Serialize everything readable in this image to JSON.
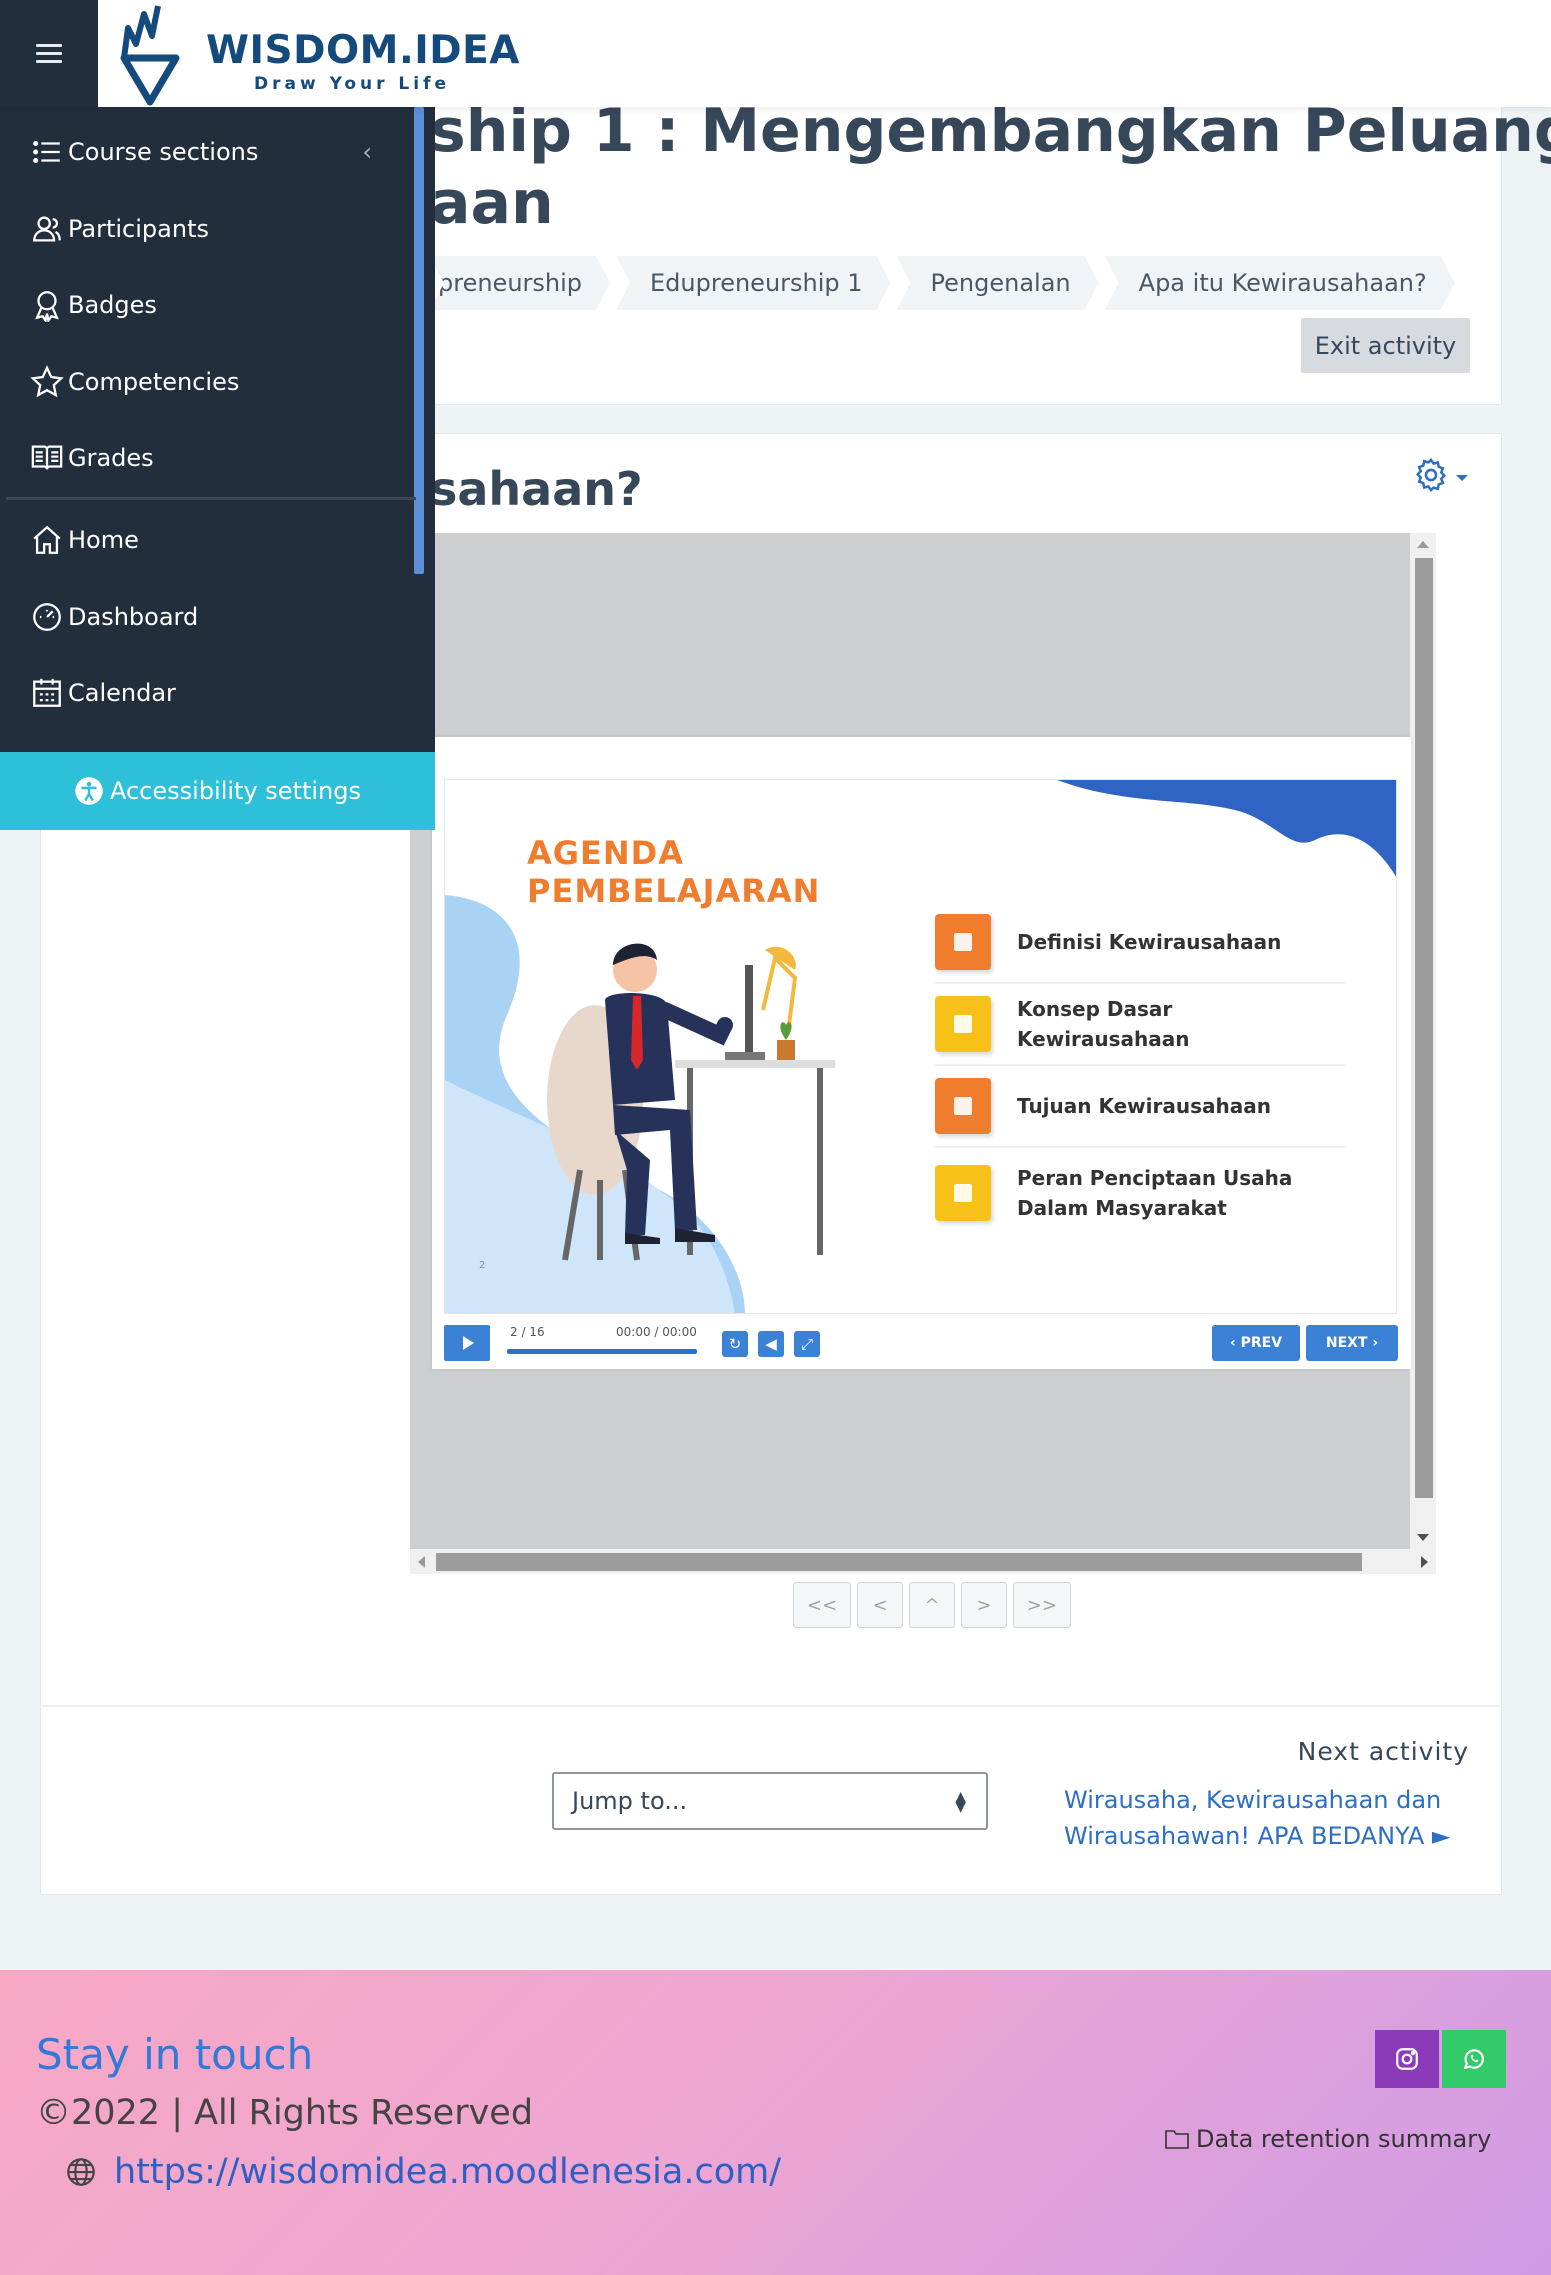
{
  "header": {
    "brand_name": "WISDOM.IDEA",
    "brand_tagline": "Draw Your Life",
    "brand_color": "#154a7c"
  },
  "sidebar": {
    "items": [
      {
        "label": "Course sections",
        "icon": "list-icon"
      },
      {
        "label": "Participants",
        "icon": "participants-icon"
      },
      {
        "label": "Badges",
        "icon": "badge-icon"
      },
      {
        "label": "Competencies",
        "icon": "star-icon"
      },
      {
        "label": "Grades",
        "icon": "grades-icon"
      },
      {
        "label": "Home",
        "icon": "home-icon"
      },
      {
        "label": "Dashboard",
        "icon": "dashboard-icon"
      },
      {
        "label": "Calendar",
        "icon": "calendar-icon"
      }
    ],
    "accessibility_label": "Accessibility settings",
    "accent_color": "#2ec0d8"
  },
  "page": {
    "title_line1": "ship 1 : Mengembangkan Peluang",
    "title_line2": "aan",
    "breadcrumbs": [
      "preneurship",
      "Edupreneurship 1",
      "Pengenalan",
      "Apa itu Kewirausahaan?"
    ],
    "exit_label": "Exit activity",
    "section_title": "sahaan?"
  },
  "slide": {
    "agenda_title_1": "AGENDA",
    "agenda_title_2": "PEMBELAJARAN",
    "items": [
      {
        "text": "Definisi Kewirausahaan",
        "color": "#f07c2e"
      },
      {
        "text": "Konsep Dasar Kewirausahaan",
        "color": "#f8c11a"
      },
      {
        "text": "Tujuan Kewirausahaan",
        "color": "#f07c2e"
      },
      {
        "text": "Peran Penciptaan Usaha Dalam Masyarakat",
        "color": "#f8c11a"
      }
    ],
    "slide_number": "2",
    "progress": "2 / 16",
    "time": "00:00 / 00:00",
    "prev_label": "‹ PREV",
    "next_label": "NEXT ›"
  },
  "pager": [
    "<<",
    "<",
    "^",
    ">",
    ">>"
  ],
  "navigation": {
    "jump_placeholder": "Jump to...",
    "next_activity_label": "Next activity",
    "next_activity_link": "Wirausaha, Kewirausahaan dan Wirausahawan! APA BEDANYA ►"
  },
  "footer": {
    "stay_in_touch": "Stay in touch",
    "copyright": "©2022 | All Rights Reserved",
    "site_url": "https://wisdomidea.moodlenesia.com/",
    "data_retention": "Data retention summary"
  }
}
